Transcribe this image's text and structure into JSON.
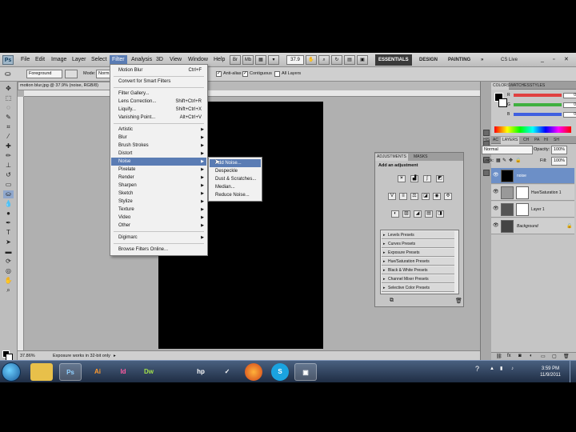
{
  "menubar": {
    "app_logo": "Ps",
    "items": [
      "File",
      "Edit",
      "Image",
      "Layer",
      "Select",
      "Filter",
      "Analysis",
      "3D",
      "View",
      "Window",
      "Help"
    ],
    "active_menu": "Filter",
    "zoom_value": "37.9",
    "workspaces": [
      "ESSENTIALS",
      "DESIGN",
      "PAINTING"
    ],
    "active_workspace": "ESSENTIALS",
    "more": "»",
    "cs_live": "CS Live"
  },
  "options_bar": {
    "fill": "Foreground",
    "mode_label": "Mode:",
    "mode_value": "Norm",
    "anti_alias": "Anti-alias",
    "contiguous": "Contiguous",
    "all_layers": "All Layers"
  },
  "document": {
    "tab_title": "motion blur.jpg @ 37.9% (noise, RGB/8)",
    "status_zoom": "37.86%",
    "status_info": "Exposure works in 32-bit only"
  },
  "filter_menu": {
    "items": [
      {
        "label": "Motion Blur",
        "shortcut": "Ctrl+F",
        "submenu": false
      },
      {
        "label": "Convert for Smart Filters",
        "shortcut": "",
        "submenu": false
      },
      {
        "label": "Filter Gallery...",
        "shortcut": "",
        "submenu": false
      },
      {
        "label": "Lens Correction...",
        "shortcut": "Shift+Ctrl+R",
        "submenu": false
      },
      {
        "label": "Liquify...",
        "shortcut": "Shift+Ctrl+X",
        "submenu": false
      },
      {
        "label": "Vanishing Point...",
        "shortcut": "Alt+Ctrl+V",
        "submenu": false
      },
      {
        "label": "Artistic",
        "shortcut": "",
        "submenu": true
      },
      {
        "label": "Blur",
        "shortcut": "",
        "submenu": true
      },
      {
        "label": "Brush Strokes",
        "shortcut": "",
        "submenu": true
      },
      {
        "label": "Distort",
        "shortcut": "",
        "submenu": true
      },
      {
        "label": "Noise",
        "shortcut": "",
        "submenu": true
      },
      {
        "label": "Pixelate",
        "shortcut": "",
        "submenu": true
      },
      {
        "label": "Render",
        "shortcut": "",
        "submenu": true
      },
      {
        "label": "Sharpen",
        "shortcut": "",
        "submenu": true
      },
      {
        "label": "Sketch",
        "shortcut": "",
        "submenu": true
      },
      {
        "label": "Stylize",
        "shortcut": "",
        "submenu": true
      },
      {
        "label": "Texture",
        "shortcut": "",
        "submenu": true
      },
      {
        "label": "Video",
        "shortcut": "",
        "submenu": true
      },
      {
        "label": "Other",
        "shortcut": "",
        "submenu": true
      },
      {
        "label": "Digimarc",
        "shortcut": "",
        "submenu": true
      },
      {
        "label": "Browse Filters Online...",
        "shortcut": "",
        "submenu": false
      }
    ],
    "highlighted": "Noise"
  },
  "noise_menu": {
    "items": [
      "Add Noise...",
      "Despeckle",
      "Dust & Scratches...",
      "Median...",
      "Reduce Noise..."
    ],
    "highlighted": "Add Noise..."
  },
  "color_panel": {
    "tabs": [
      "COLOR",
      "SWATCHES",
      "STYLES"
    ],
    "channels": [
      {
        "label": "R",
        "value": "0",
        "color": "#e04040"
      },
      {
        "label": "G",
        "value": "0",
        "color": "#40b040"
      },
      {
        "label": "B",
        "value": "0",
        "color": "#4060e0"
      }
    ]
  },
  "mini_tabs": [
    "HIS",
    "AC"
  ],
  "layers_panel": {
    "tabs": [
      "LAYERS",
      "CH",
      "PA",
      "HI",
      "SH"
    ],
    "blend_mode": "Normal",
    "opacity_label": "Opacity:",
    "opacity_value": "100%",
    "lock_label": "Lock:",
    "fill_label": "Fill:",
    "fill_value": "100%",
    "layers": [
      {
        "name": "noise",
        "selected": true
      },
      {
        "name": "Hue/Saturation 1",
        "selected": false
      },
      {
        "name": "Layer 1",
        "selected": false
      },
      {
        "name": "Background",
        "selected": false
      }
    ]
  },
  "adjustments_panel": {
    "tabs": [
      "ADJUSTMENTS",
      "MASKS"
    ],
    "title": "Add an adjustment",
    "presets": [
      "Levels Presets",
      "Curves Presets",
      "Exposure Presets",
      "Hue/Saturation Presets",
      "Black & White Presets",
      "Channel Mixer Presets",
      "Selective Color Presets"
    ]
  },
  "taskbar": {
    "apps": [
      {
        "icon": "windows-explorer-icon",
        "label": "",
        "color": "#e8c04a"
      },
      {
        "icon": "photoshop-icon",
        "label": "Ps",
        "color": "#1f5b8f"
      },
      {
        "icon": "illustrator-icon",
        "label": "Ai",
        "color": "#a44f10"
      },
      {
        "icon": "indesign-icon",
        "label": "Id",
        "color": "#8a1f4a"
      },
      {
        "icon": "dreamweaver-icon",
        "label": "Dw",
        "color": "#4a7a1f"
      },
      {
        "icon": "hp-icon",
        "label": "hp",
        "color": "#2d6fb4"
      },
      {
        "icon": "checkmark-app-icon",
        "label": "✓",
        "color": "#2c5f9f"
      },
      {
        "icon": "firefox-icon",
        "label": "",
        "color": "#e46a1b"
      },
      {
        "icon": "skype-icon",
        "label": "S",
        "color": "#1aa3e0"
      },
      {
        "icon": "screen-capture-icon",
        "label": "",
        "color": "#3e6fb1"
      }
    ],
    "time": "3:59 PM",
    "date": "11/9/2011"
  }
}
